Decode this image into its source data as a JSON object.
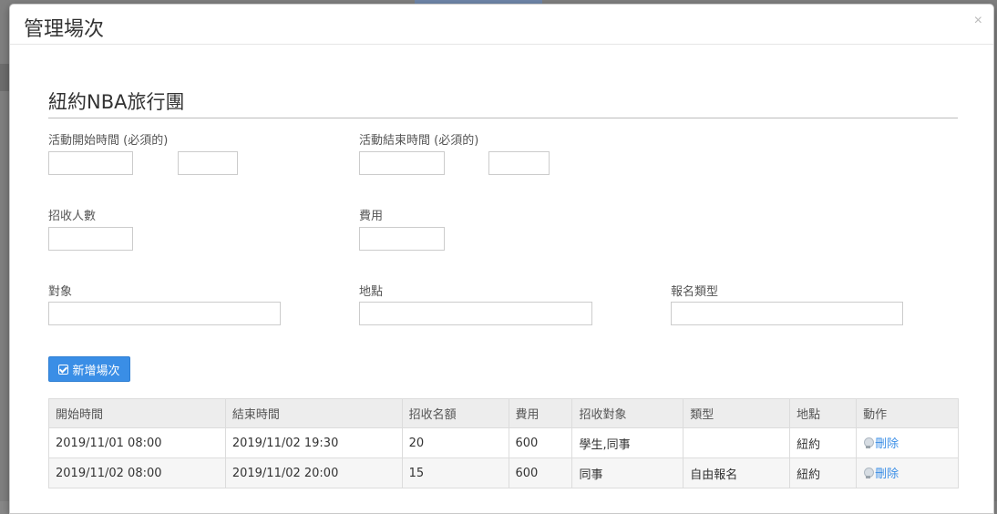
{
  "modal": {
    "title": "管理場次",
    "close_label": "×"
  },
  "section": {
    "title": "紐約NBA旅行團"
  },
  "form": {
    "start_label": "活動開始時間 (必須的)",
    "end_label": "活動結束時間 (必須的)",
    "quota_label": "招收人數",
    "fee_label": "費用",
    "target_label": "對象",
    "location_label": "地點",
    "signup_type_label": "報名類型",
    "start_date_value": "",
    "start_time_value": "",
    "end_date_value": "",
    "end_time_value": "",
    "quota_value": "",
    "fee_value": "",
    "target_value": "",
    "location_value": "",
    "signup_type_value": ""
  },
  "add_button": {
    "label": "新增場次",
    "icon": "check-square-icon",
    "color": "#3a8ee6"
  },
  "table": {
    "headers": [
      "開始時間",
      "結束時間",
      "招收名額",
      "費用",
      "招收對象",
      "類型",
      "地點",
      "動作"
    ],
    "rows": [
      {
        "start": "2019/11/01 08:00",
        "end": "2019/11/02 19:30",
        "quota": "20",
        "fee": "600",
        "target": "學生,同事",
        "type": "",
        "location": "紐約",
        "action": "刪除"
      },
      {
        "start": "2019/11/02 08:00",
        "end": "2019/11/02 20:00",
        "quota": "15",
        "fee": "600",
        "target": "同事",
        "type": "自由報名",
        "location": "紐約",
        "action": "刪除"
      }
    ]
  }
}
